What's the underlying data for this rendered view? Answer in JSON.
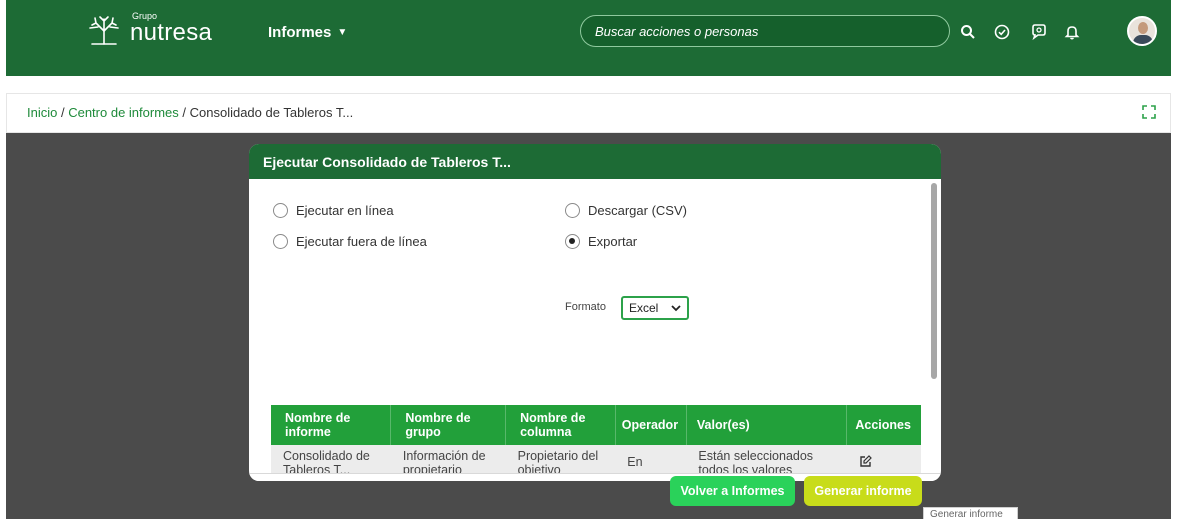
{
  "header": {
    "logo_small": "Grupo",
    "logo_name": "nutresa",
    "menu_label": "Informes",
    "search_placeholder": "Buscar acciones o personas",
    "icons": [
      "search-icon",
      "check-circle-icon",
      "chat-icon",
      "bell-icon"
    ]
  },
  "breadcrumb": {
    "home": "Inicio",
    "sep1": " / ",
    "center": "Centro de informes",
    "sep2": " / ",
    "current": "Consolidado de Tableros T..."
  },
  "modal": {
    "title": "Ejecutar Consolidado de Tableros T...",
    "options": {
      "online": "Ejecutar en línea",
      "offline": "Ejecutar fuera de línea",
      "download_csv": "Descargar (CSV)",
      "export": "Exportar"
    },
    "selected_option": "export",
    "format_label": "Formato",
    "format_value": "Excel",
    "table": {
      "headers": [
        "Nombre de informe",
        "Nombre de grupo",
        "Nombre de columna",
        "Operador",
        "Valor(es)",
        "Acciones"
      ],
      "rows": [
        [
          "Consolidado de Tableros T...",
          "Información de propietario",
          "Propietario del objetivo",
          "En",
          "Están seleccionados todos los valores",
          ""
        ]
      ]
    },
    "buttons": {
      "back": "Volver a Informes",
      "generate": "Generar informe"
    },
    "tooltip": "Generar informe"
  },
  "colors": {
    "brand_green": "#1d6b35",
    "table_header": "#22a03a",
    "back_button": "#2ad25a",
    "generate_button": "#c8dc1a"
  }
}
